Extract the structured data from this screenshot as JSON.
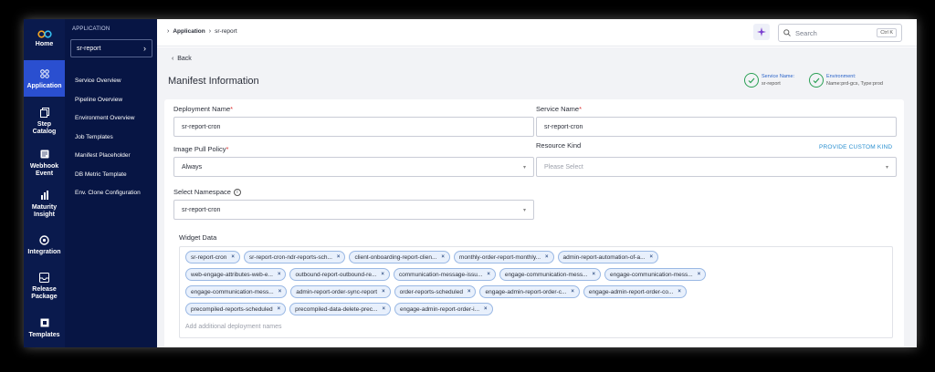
{
  "rail": {
    "home": "Home",
    "items": [
      {
        "label": "Application",
        "icon": "grid-icon"
      },
      {
        "label": "Step Catalog",
        "icon": "catalog-icon"
      },
      {
        "label": "Webhook Event",
        "icon": "webhook-icon"
      },
      {
        "label": "Maturity Insight",
        "icon": "bar-chart-icon"
      },
      {
        "label": "Integration",
        "icon": "integration-icon"
      },
      {
        "label": "Release Package",
        "icon": "package-icon"
      },
      {
        "label": "Templates",
        "icon": "templates-icon"
      }
    ]
  },
  "appbar": {
    "section_label": "APPLICATION",
    "selected_app": "sr-report",
    "nav": [
      "Service Overview",
      "Pipeline Overview",
      "Environment Overview",
      "Job Templates",
      "Manifest Placeholder",
      "DB Metric Template",
      "Env. Clone Configuration"
    ]
  },
  "topbar": {
    "breadcrumb": [
      "Application",
      "sr-report"
    ],
    "search_placeholder": "Search",
    "search_shortcut": "Ctrl K"
  },
  "main": {
    "back_label": "Back",
    "title": "Manifest Information",
    "service_name_key": "Service Name:",
    "service_name_value": "sr-report",
    "environment_key": "Environment:",
    "environment_value": "Name:prd-gcs, Type:prod"
  },
  "form": {
    "deployment_name_label": "Deployment Name",
    "deployment_name_value": "sr-report-cron",
    "service_name_label": "Service Name",
    "service_name_value": "sr-report-cron",
    "image_pull_policy_label": "Image Pull Policy",
    "image_pull_policy_value": "Always",
    "resource_kind_label": "Resource Kind",
    "resource_kind_placeholder": "Please Select",
    "provide_custom_kind": "PROVIDE CUSTOM KIND",
    "namespace_label": "Select Namespace",
    "namespace_value": "sr-report-cron",
    "widget_label": "Widget Data",
    "chip_rows": [
      [
        "sr-report-cron",
        "sr-report-cron-ndr-reports-sch...",
        "client-onboarding-report-clien...",
        "monthly-order-report-monthly...",
        "admin-report-automation-of-a..."
      ],
      [
        "web-engage-attributes-web-e...",
        "outbound-report-outbound-re...",
        "communication-message-issu...",
        "engage-communication-mess...",
        "engage-communication-mess..."
      ],
      [
        "engage-communication-mess...",
        "admin-report-order-sync-report",
        "order-reports-scheduled",
        "engage-admin-report-order-c...",
        "engage-admin-report-order-co..."
      ],
      [
        "precompiled-reports-scheduled",
        "precompiled-data-delete-prec...",
        "engage-admin-report-order-i..."
      ]
    ],
    "add_names_placeholder": "Add additional deployment names"
  },
  "colors": {
    "rail_bg": "#0a1a4d",
    "appbar_bg": "#071544",
    "active": "#2a4fd0",
    "chip_bg": "#e8f0fc",
    "success": "#2ba055"
  }
}
